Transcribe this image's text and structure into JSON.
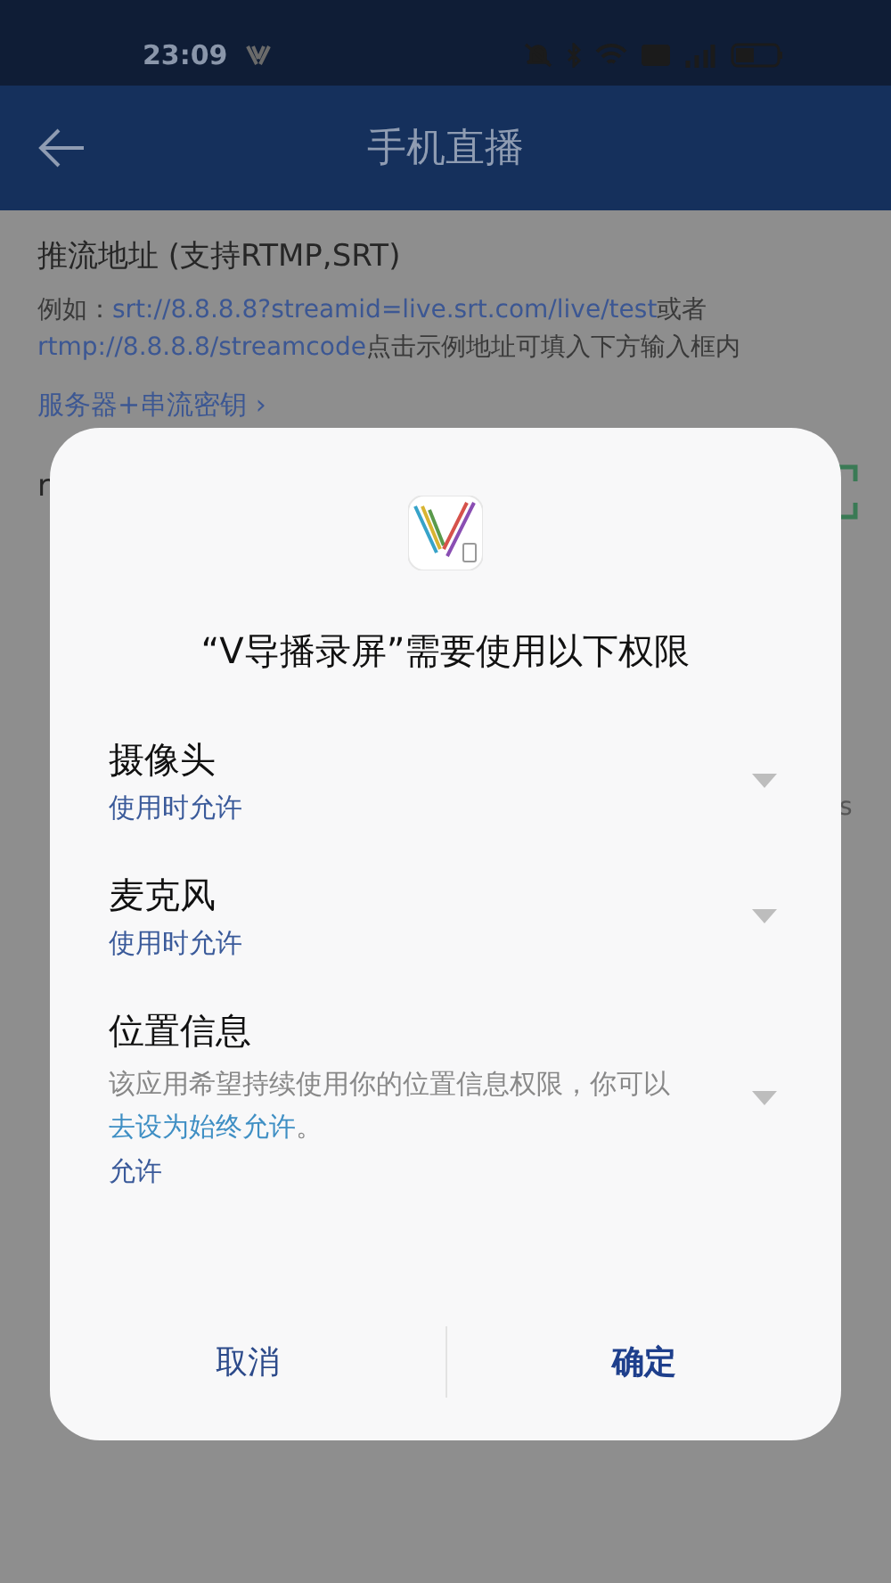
{
  "status_bar": {
    "time": "23:09"
  },
  "header": {
    "title": "手机直播"
  },
  "page": {
    "section_title": "推流地址 (支持RTMP,SRT)",
    "example": {
      "prefix": "例如：",
      "link_1": "srt://8.8.8.8?streamid=live.srt.com/live/test",
      "middle": "或者",
      "link_2": "rtmp://8.8.8.8/streamcode",
      "suffix": "点击示例地址可填入下方输入框内"
    },
    "mode_link": "服务器+串流密钥 ›",
    "input": {
      "value": "r"
    },
    "row_fragment": "s"
  },
  "dialog": {
    "title": "“V导播录屏”需要使用以下权限",
    "permissions": [
      {
        "name": "摄像头",
        "kind": "simple",
        "status": "使用时允许"
      },
      {
        "name": "麦克风",
        "kind": "simple",
        "status": "使用时允许"
      },
      {
        "name": "位置信息",
        "kind": "note",
        "note": "该应用希望持续使用你的位置信息权限，你可以",
        "note_link": "去设为始终允许",
        "note_end": "。",
        "status": "允许"
      }
    ],
    "buttons": [
      {
        "label": "取消",
        "primary": false
      },
      {
        "label": "确定",
        "primary": true
      }
    ]
  }
}
